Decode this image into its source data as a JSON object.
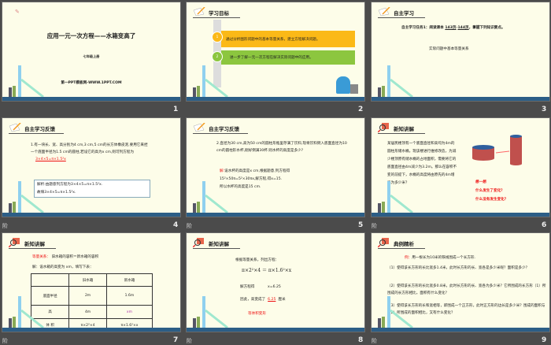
{
  "slides": [
    {
      "number": "1",
      "title": "应用一元一次方程——水箱变高了",
      "subtitle": "七年级上册",
      "footer": "第一PPT模板网-WWW.1PPT.COM"
    },
    {
      "number": "2",
      "header": "学习目标",
      "goals": [
        "通过分析图形问题中的基本等量关系，建立方程解决问题。",
        "进一步了解一元一次方程在解决实际问题中的应用。"
      ],
      "markers": [
        "1",
        "2"
      ]
    },
    {
      "number": "3",
      "header": "自主学习",
      "task_prefix": "自主学习任务1：阅读课本",
      "page_from": "143页",
      "dash": "-",
      "page_to": "144页",
      "task_suffix": "，掌握下列知识要点。",
      "point": "实际问题中基本等量关系"
    },
    {
      "number": "4",
      "header": "自主学习反馈",
      "question": "1.有一块长、宽、高分别为4 cm,3 cm,5 cm的长方体橡皮泥,要用它来捏一个底面半径为1.5 cm的圆柱,若设它的高为x cm,则可列方程为",
      "answer": "3×4×5=π×1.5²x",
      "analysis_1": "解析:由题意列方程为3×4×5=π×1.5²x.",
      "analysis_2": "故填3×4×5=π×1.5²x.",
      "anim": "阶"
    },
    {
      "number": "5",
      "header": "自主学习反馈",
      "question": "2.直径为30 cm,高为50 cm的圆柱形瓶里存满了饮料,现将饮料倒入底面直径为10 cm的圆柱形水杯,刚好倒满30杯.则水杯的高度是多少?",
      "sol_label": "解:",
      "sol_1": "设水杯的高度是x cm,根据题意,列方程得",
      "sol_2": "15²×50π=5²×30πx,解方程,得x=15.",
      "sol_3": "所以水杯的高度是15 cm.",
      "anim": "阶"
    },
    {
      "number": "6",
      "header": "新知讲解",
      "problem": "某居民楼顶有一个底面直径和高均为4m的圆柱形储水桶。现该楼进行维修改造，为减少楼顶原有储水桶的占地面积，需要将它的底面直径由4m减少为3.2m。那么在容积不变的前提下，水桶的高度将由原先的4m增高为多少米？",
      "think": "想一想",
      "q1": "什么发生了变化？",
      "q2": "什么没有发生变化？",
      "anim": "阶"
    },
    {
      "number": "7",
      "header": "新知讲解",
      "relation_label": "等量关系：",
      "relation": "旧水箱的容积＝新水箱的容积",
      "setup": "解：设水箱的高变为 xm，填写下表：",
      "table": {
        "headers": [
          "",
          "旧水箱",
          "新水箱"
        ],
        "rows": [
          [
            "底面半径",
            "2m",
            "1.6m"
          ],
          [
            "高",
            "4m",
            "xm"
          ],
          [
            "体 积",
            "π×2²×4",
            "π×1.6²×x"
          ]
        ]
      },
      "anim": "阶"
    },
    {
      "number": "8",
      "header": "新知讲解",
      "intro": "根据等量关系，列出方程：",
      "equation": "π×2²×4 ＝ π×1.6²×x",
      "solve_label": "解方程得",
      "solution": "x=6.25",
      "concl_prefix": "因此，高变成了",
      "concl_value": "6.25",
      "concl_suffix": "厘米",
      "note": "等体积变形",
      "anim": "阶"
    },
    {
      "number": "9",
      "header": "典例精析",
      "ex_label": "例：",
      "example": "用一根长为10米的铁线围成一个长方形.",
      "parts": [
        "（1）使得该长方形的长比宽多1.4米，此时长方形的长、宽各是多少米呢？面积是多少？",
        "（2）使得该长方形的长比宽多0.8米，此时长方形的长、宽各为多少米？它所围成的长方形（1）所围成的长方形相比，面积有什么变化？",
        "（3）使得该长方形的长和宽相等，即围成一个正方形，此时正方形的边长是多少米？围成的面积与（2）所围成的面积相比，又有什么变化？"
      ],
      "anim": "阶"
    }
  ]
}
